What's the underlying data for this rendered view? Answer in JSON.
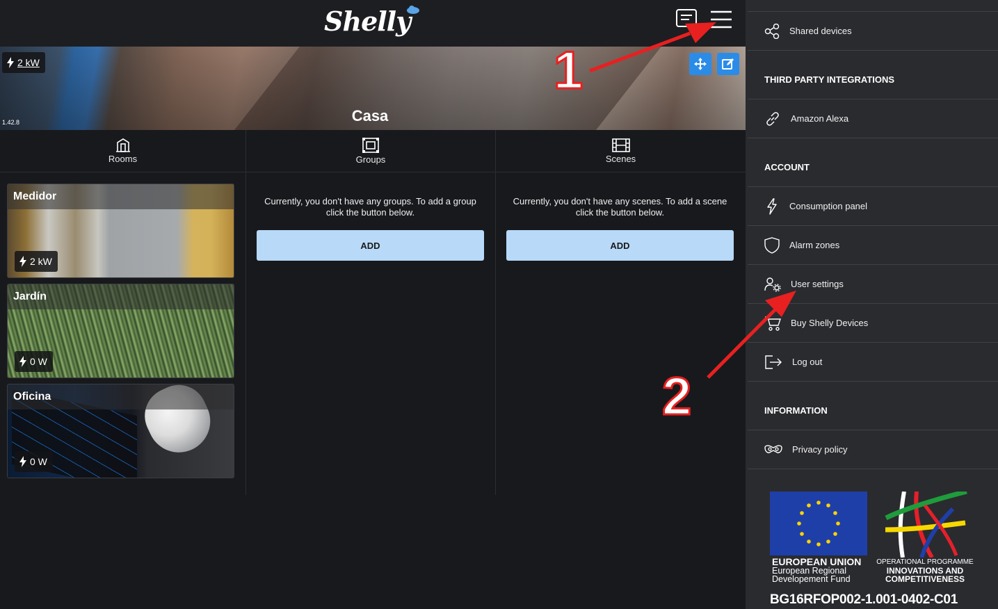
{
  "header": {
    "logo_text": "Shelly"
  },
  "hero": {
    "power_value": "2 kW",
    "version": "1.42.8",
    "title": "Casa"
  },
  "tabs": [
    {
      "label": "Rooms"
    },
    {
      "label": "Groups"
    },
    {
      "label": "Scenes"
    }
  ],
  "rooms": [
    {
      "name": "Medidor",
      "power": "2 kW"
    },
    {
      "name": "Jardín",
      "power": "0 W"
    },
    {
      "name": "Oficina",
      "power": "0 W"
    }
  ],
  "groups": {
    "empty_message": "Currently, you don't have any groups. To add a group click the button below.",
    "add_label": "ADD"
  },
  "scenes": {
    "empty_message": "Currently, you don't have any scenes. To add a scene click the button below.",
    "add_label": "ADD"
  },
  "sidebar": {
    "shared_devices": "Shared devices",
    "third_party_heading": "THIRD PARTY INTEGRATIONS",
    "amazon_alexa": "Amazon Alexa",
    "account_heading": "ACCOUNT",
    "consumption_panel": "Consumption panel",
    "alarm_zones": "Alarm zones",
    "user_settings": "User settings",
    "buy_devices": "Buy Shelly Devices",
    "log_out": "Log out",
    "information_heading": "INFORMATION",
    "privacy_policy": "Privacy policy"
  },
  "footer": {
    "eu_line1": "EUROPEAN UNION",
    "eu_line2": "European Regional",
    "eu_line3": "Developement Fund",
    "op_line1": "OPERATIONAL PROGRAMME",
    "op_line2": "INNOVATIONS AND",
    "op_line3": "COMPETITIVENESS",
    "grant_code": "BG16RFOP002-1.001-0402-C01"
  },
  "annotations": {
    "step1": "1",
    "step2": "2"
  },
  "colors": {
    "accent_blue": "#2b8ce8",
    "add_button": "#b8d9f8",
    "annotation_red": "#e82020"
  }
}
